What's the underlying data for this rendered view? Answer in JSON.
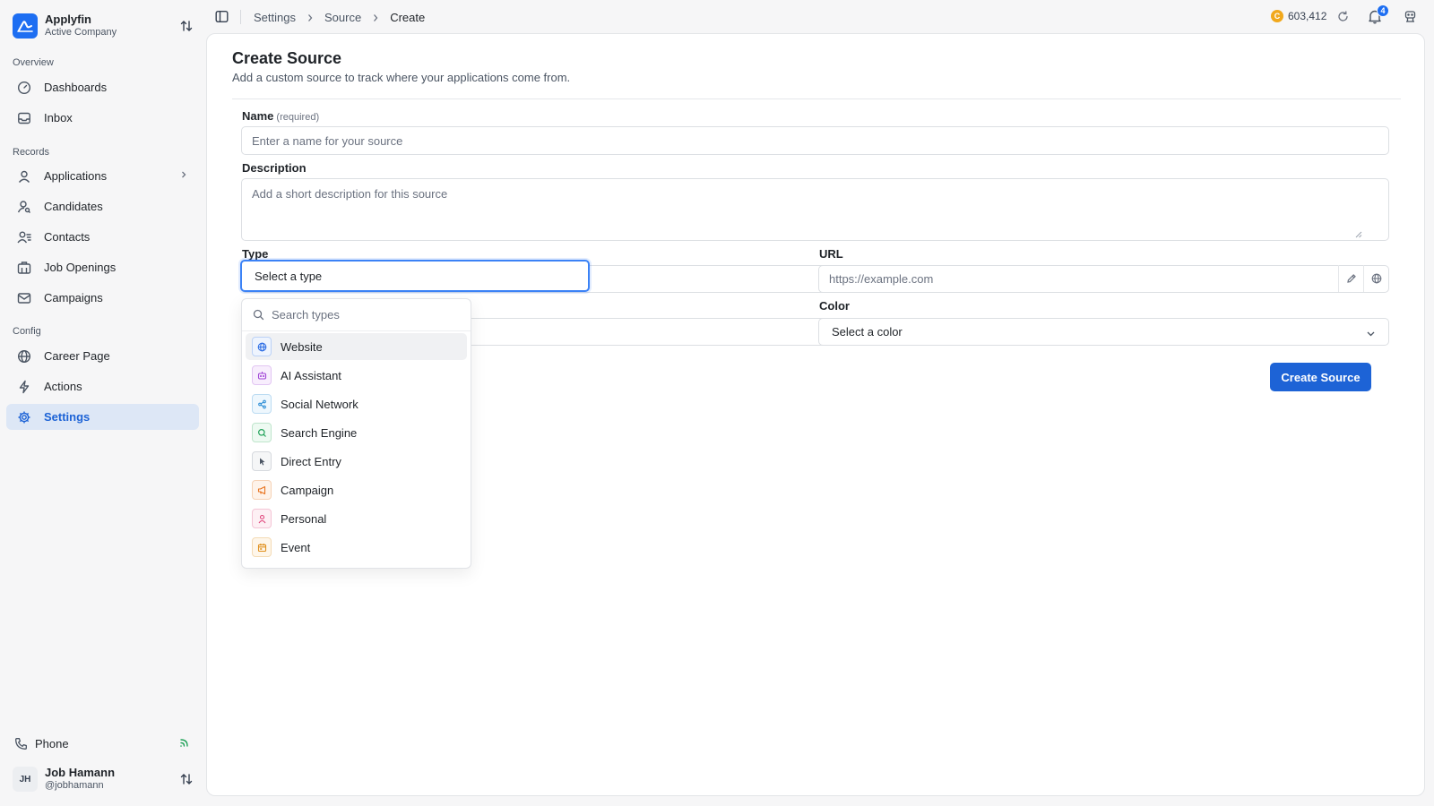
{
  "brand": {
    "name": "Applyfin",
    "subtitle": "Active Company"
  },
  "sidebar": {
    "groups": [
      {
        "label": "Overview"
      },
      {
        "label": "Records"
      },
      {
        "label": "Config"
      }
    ],
    "items": [
      {
        "label": "Dashboards",
        "icon": "gauge-icon"
      },
      {
        "label": "Inbox",
        "icon": "inbox-icon"
      },
      {
        "label": "Applications",
        "icon": "user-icon"
      },
      {
        "label": "Candidates",
        "icon": "user-search-icon"
      },
      {
        "label": "Contacts",
        "icon": "contacts-icon"
      },
      {
        "label": "Job Openings",
        "icon": "building-icon"
      },
      {
        "label": "Campaigns",
        "icon": "mail-icon"
      },
      {
        "label": "Career Page",
        "icon": "globe-icon"
      },
      {
        "label": "Actions",
        "icon": "bolt-icon"
      },
      {
        "label": "Settings",
        "icon": "gear-icon",
        "active": true
      }
    ],
    "phone": {
      "label": "Phone"
    },
    "user": {
      "initials": "JH",
      "name": "Job Hamann",
      "handle": "@jobhamann"
    }
  },
  "topbar": {
    "breadcrumb": [
      "Settings",
      "Source",
      "Create"
    ],
    "credits": {
      "coin": "C",
      "amount": "603,412"
    },
    "notifications_count": "4"
  },
  "form": {
    "title": "Create Source",
    "subtitle": "Add a custom source to track where your applications come from.",
    "name": {
      "label": "Name",
      "required_note": "(required)",
      "placeholder": "Enter a name for your source",
      "value": ""
    },
    "description": {
      "label": "Description",
      "placeholder": "Add a short description for this source",
      "value": ""
    },
    "type": {
      "label": "Type",
      "value": "Select a type"
    },
    "url": {
      "label": "URL",
      "placeholder": "https://example.com",
      "value": ""
    },
    "color": {
      "label": "Color",
      "value": "Select a color"
    },
    "submit_label": "Create Source"
  },
  "type_dropdown": {
    "search_placeholder": "Search types",
    "options": [
      {
        "label": "Website",
        "icon": "globe-icon",
        "color": "#2f6fe4",
        "highlighted": true
      },
      {
        "label": "AI Assistant",
        "icon": "bot-icon",
        "color": "#a044d6"
      },
      {
        "label": "Social Network",
        "icon": "share-icon",
        "color": "#2f8fd6"
      },
      {
        "label": "Search Engine",
        "icon": "search-icon",
        "color": "#22a35a"
      },
      {
        "label": "Direct Entry",
        "icon": "cursor-icon",
        "color": "#4b5563"
      },
      {
        "label": "Campaign",
        "icon": "megaphone-icon",
        "color": "#e8731e"
      },
      {
        "label": "Personal",
        "icon": "person-icon",
        "color": "#e0457b"
      },
      {
        "label": "Event",
        "icon": "calendar-icon",
        "color": "#e0901e"
      }
    ]
  }
}
